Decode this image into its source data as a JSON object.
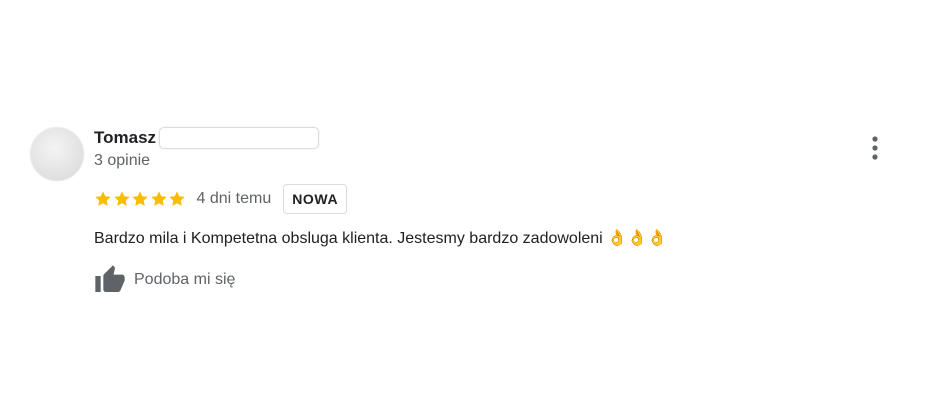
{
  "review": {
    "reviewer_name": "Tomasz",
    "review_count": "3 opinie",
    "rating": 5,
    "rating_max": 5,
    "date": "4 dni temu",
    "badge": "NOWA",
    "text": "Bardzo mila i Kompetetna obsluga klienta. Jestesmy bardzo zadowoleni 👌👌👌",
    "like_label": "Podoba mi się"
  },
  "colors": {
    "star": "#fbbc04",
    "primary_text": "#202124",
    "secondary_text": "#5f6368",
    "icon_gray": "#5f6368"
  },
  "icons": {
    "avatar": "avatar",
    "star": "star-icon",
    "like": "thumbs-up-icon",
    "more": "more-vert-icon"
  }
}
